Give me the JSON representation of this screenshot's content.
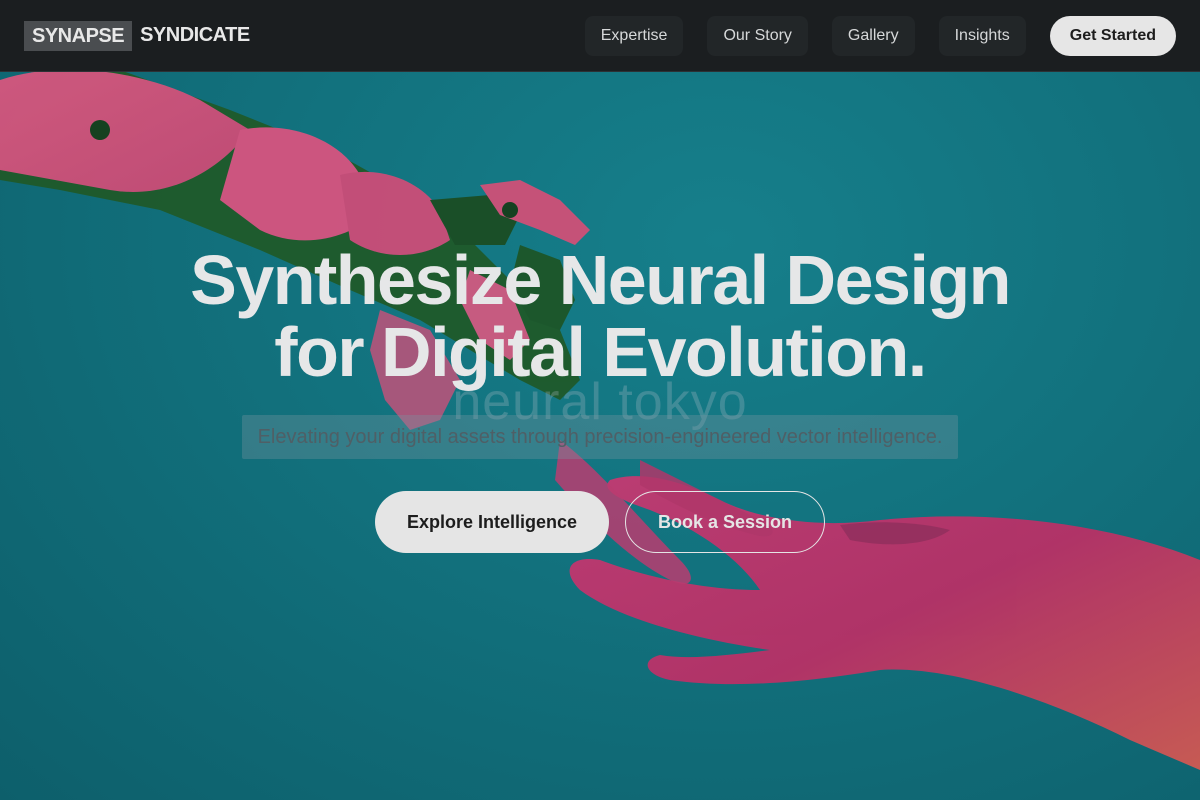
{
  "header": {
    "logo": {
      "box_text": "SYNAPSE",
      "text": "SYNDICATE"
    },
    "nav": [
      {
        "label": "Expertise"
      },
      {
        "label": "Our Story"
      },
      {
        "label": "Gallery"
      },
      {
        "label": "Insights"
      }
    ],
    "cta_label": "Get Started"
  },
  "hero": {
    "headline_line1": "Synthesize Neural Design",
    "headline_line2": "for Digital Evolution.",
    "watermark": "neural tokyo",
    "subtitle": "Elevating your digital assets through precision-engineered vector intelligence.",
    "primary_button": "Explore Intelligence",
    "secondary_button": "Book a Session"
  },
  "colors": {
    "header_bg": "#1b1e20",
    "hero_teal": "#12717d",
    "robot_pink": "#d9507a",
    "robot_green": "#1f5a2a",
    "hand_magenta": "#c8326e",
    "text_light": "#e6e7e8"
  }
}
